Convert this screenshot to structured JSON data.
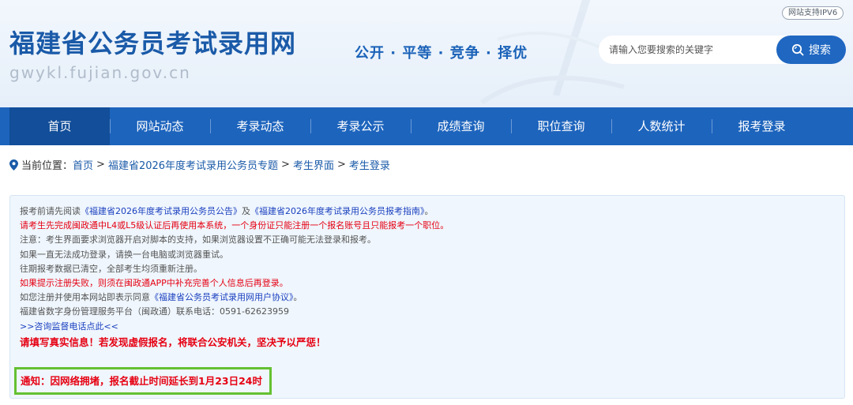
{
  "header": {
    "site_title": "福建省公务员考试录用网",
    "site_domain": "gwykl.fujian.gov.cn",
    "slogan": "公开 · 平等 · 竞争 · 择优",
    "ipv6_badge": "网站支持IPV6",
    "search_placeholder": "请输入您要搜索的关键字",
    "search_button": "搜索"
  },
  "nav": {
    "items": [
      "首页",
      "网站动态",
      "考录动态",
      "考录公示",
      "成绩查询",
      "职位查询",
      "人数统计",
      "报考登录"
    ],
    "active_index": 0
  },
  "breadcrumb": {
    "prefix": "当前位置：",
    "items": [
      "首页",
      "福建省2026年度考试录用公务员专题",
      "考生界面",
      "考生登录"
    ],
    "separator": ">"
  },
  "notice": {
    "line1": {
      "pre": "报考前请先阅读",
      "link1": "《福建省2026年度考试录用公务员公告》",
      "mid": "及",
      "link2": "《福建省2026年度考试录用公务员报考指南》",
      "post": "。"
    },
    "line2": "请考生先完成闽政通中L4或L5级认证后再使用本系统，一个身份证只能注册一个报名账号且只能报考一个职位。",
    "line3": "注意：考生界面要求浏览器开启对脚本的支持，如果浏览器设置不正确可能无法登录和报考。",
    "line4": "如果一直无法成功登录，请换一台电脑或浏览器重试。",
    "line5": "往期报考数据已清空，全部考生均须重新注册。",
    "line6": "如果提示注册失败，则须在闽政通APP中补充完善个人信息后再登录。",
    "line7": {
      "pre": "如您注册并使用本网站即表示同意",
      "link": "《福建省公务员考试录用网用户协议》",
      "post": "。"
    },
    "line8": "福建省数字身份管理服务平台（闽政通）联系电话：0591-62623959",
    "line9": ">>咨询监督电话点此<<",
    "warning": "请填写真实信息！若发现虚假报名，将联合公安机关，坚决予以严惩！",
    "notification": "通知：因网络拥堵，报名截止时间延长到1月23日24时"
  },
  "colors": {
    "brand_blue": "#1d64bd",
    "nav_active": "#124e99",
    "warning_red": "#e60012",
    "notify_border": "#64c132"
  }
}
